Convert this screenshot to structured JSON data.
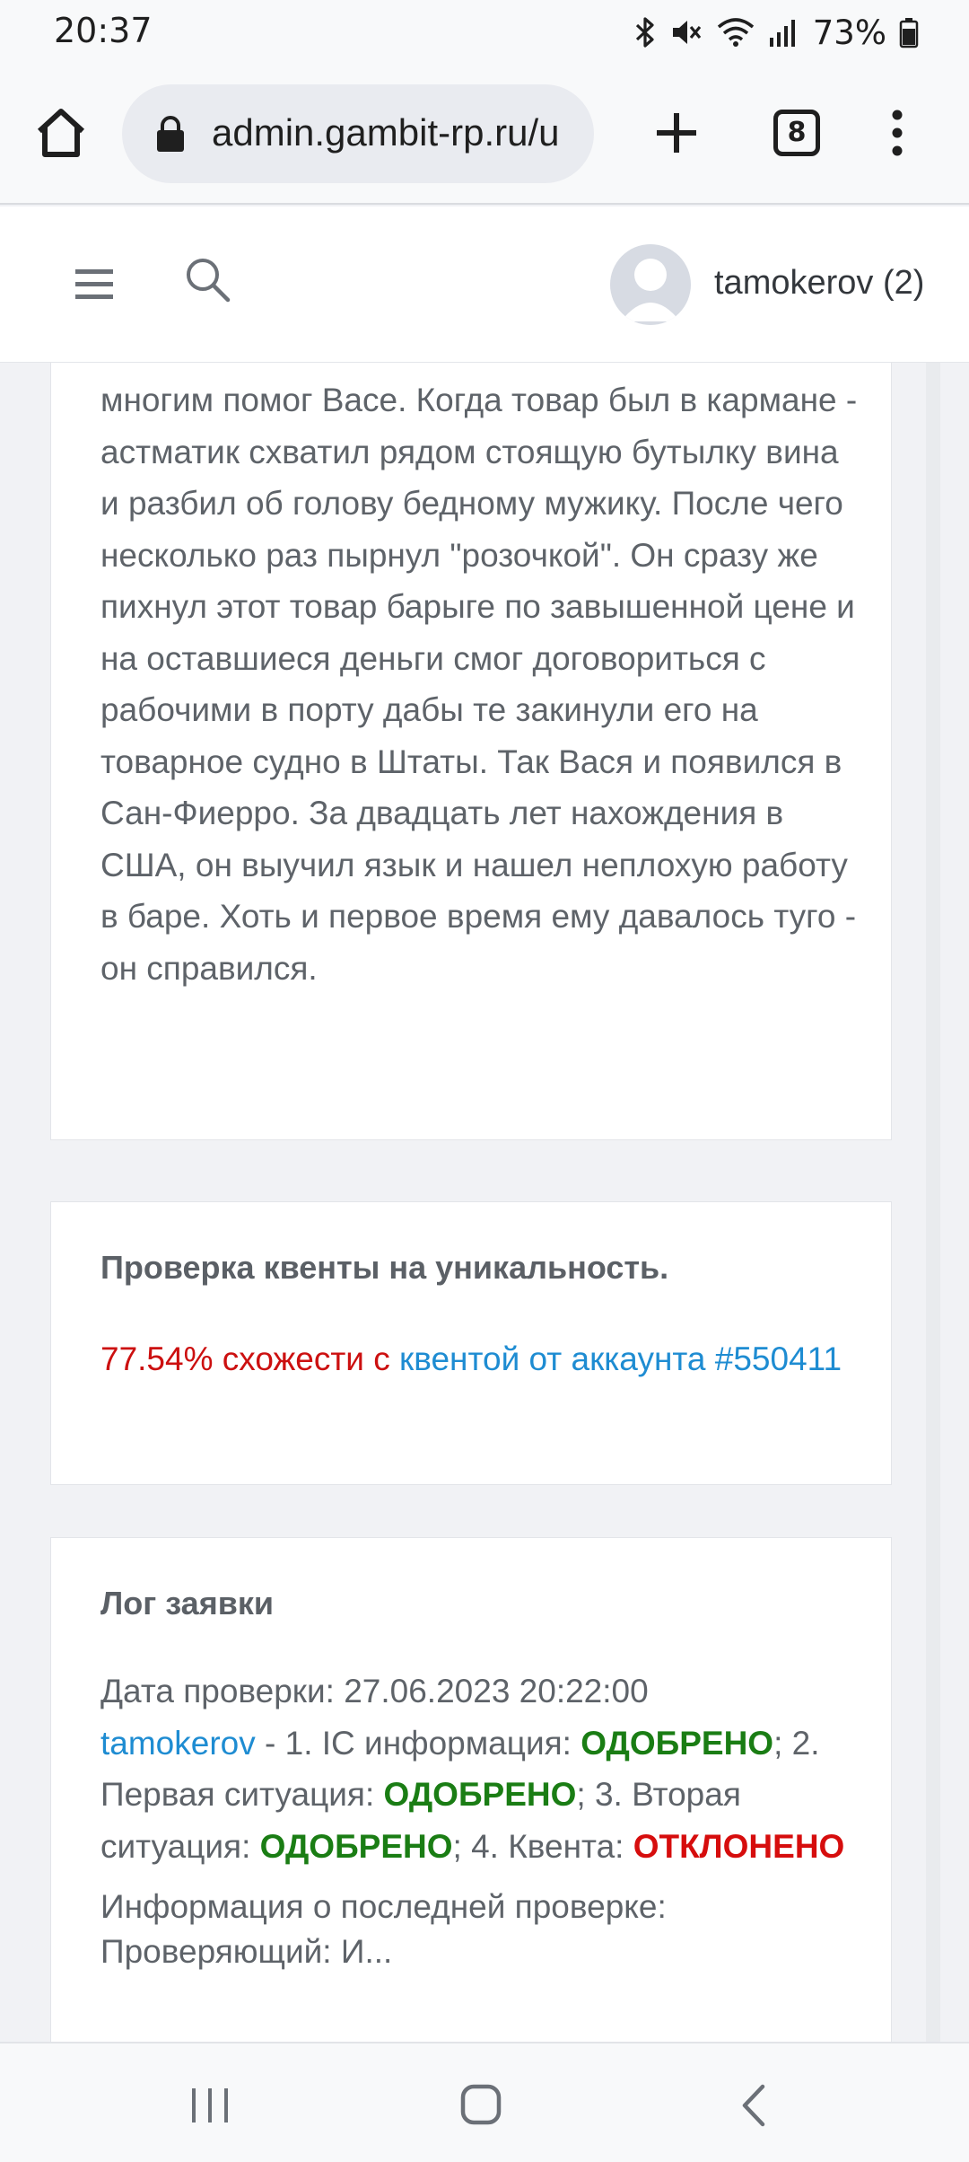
{
  "status": {
    "time": "20:37",
    "battery_pct": "73%",
    "icons": [
      "bluetooth-icon",
      "mute-icon",
      "wifi-icon",
      "signal-icon",
      "battery-icon"
    ]
  },
  "browser": {
    "url": "admin.gambit-rp.ru/u",
    "tab_count": "8",
    "icons": [
      "home-icon",
      "lock-icon",
      "plus-icon",
      "tabs-icon",
      "more-vert-icon"
    ]
  },
  "header": {
    "username": "tamokerov (2)",
    "icons": [
      "hamburger-icon",
      "search-icon",
      "avatar-icon"
    ]
  },
  "story": {
    "text": "многим помог Васе. Когда товар был в кармане - астматик схватил рядом стоящую бутылку вина и разбил об голову бедному мужику. После чего несколько раз пырнул \"розочкой\". Он сразу же пихнул этот товар барыге по завышенной цене и на оставшиеся деньги смог договориться с рабочими в порту дабы те закинули его на товарное судно в Штаты. Так Вася и появился в Сан-Фиерро. За двадцать лет нахождения в США, он выучил язык и нашел неплохую работу в баре. Хоть и первое время ему давалось туго - он справился."
  },
  "uniqueness": {
    "title": "Проверка квенты на уникальность.",
    "similarity": "77.54% схожести с",
    "link": "квентой от аккаунта #550411"
  },
  "log": {
    "title": "Лог заявки",
    "date_line": "Дата проверки: 27.06.2023 20:22:00",
    "reviewer": "tamokerov",
    "seg1": " - 1. IC информация: ",
    "status1": "ОДОБРЕНО",
    "seg2": "; 2. Первая ситуация: ",
    "status2": "ОДОБРЕНО",
    "seg3": "; 3. Вторая ситуация: ",
    "status3": "ОДОБРЕНО",
    "seg4": "; 4. Квента: ",
    "status4": "ОТКЛОНЕНО",
    "last_check_label": "Информация о последней проверке:",
    "last_check_partial": "Проверяющий: И..."
  },
  "navbar": {
    "icons": [
      "recent-apps-icon",
      "home-nav-icon",
      "back-icon"
    ]
  },
  "colors": {
    "approved": "#1a7d14",
    "rejected": "#d60d0d",
    "link": "#1e8cd2",
    "similarity": "#cc1010"
  }
}
